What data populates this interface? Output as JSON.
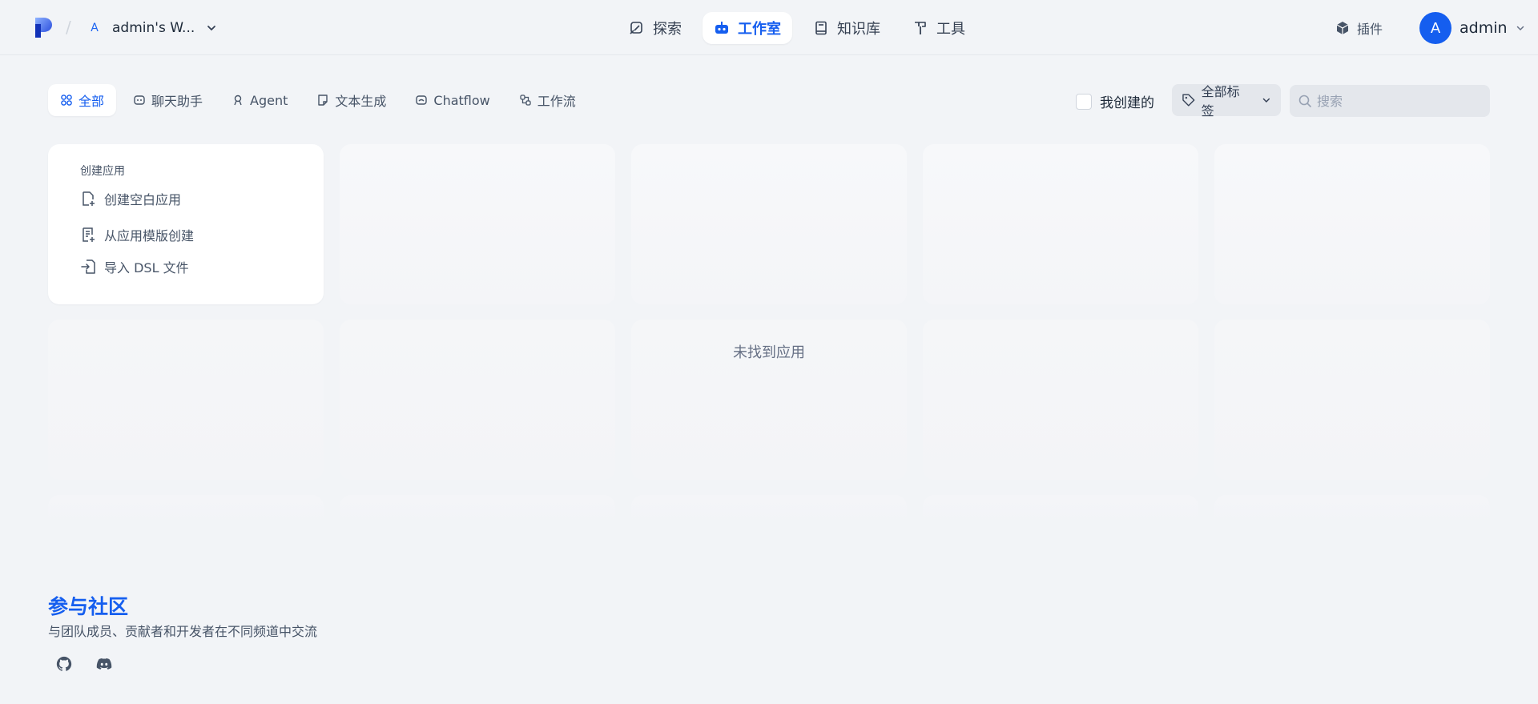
{
  "header": {
    "workspace": {
      "avatar_letter": "A",
      "name": "admin's W..."
    },
    "nav": [
      {
        "label": "探索",
        "icon": "explore-icon",
        "active": false
      },
      {
        "label": "工作室",
        "icon": "robot-icon",
        "active": true
      },
      {
        "label": "知识库",
        "icon": "book-icon",
        "active": false
      },
      {
        "label": "工具",
        "icon": "hammer-icon",
        "active": false
      }
    ],
    "plugins_label": "插件",
    "user": {
      "avatar_letter": "A",
      "name": "admin"
    }
  },
  "filters": {
    "tabs": [
      {
        "label": "全部",
        "icon": "grid-icon",
        "active": true
      },
      {
        "label": "聊天助手",
        "icon": "chat-bot-icon",
        "active": false
      },
      {
        "label": "Agent",
        "icon": "agent-icon",
        "active": false
      },
      {
        "label": "文本生成",
        "icon": "note-icon",
        "active": false
      },
      {
        "label": "Chatflow",
        "icon": "chatflow-icon",
        "active": false
      },
      {
        "label": "工作流",
        "icon": "workflow-icon",
        "active": false
      }
    ],
    "mine_label": "我创建的",
    "tag_label": "全部标签",
    "search_placeholder": "搜索"
  },
  "create_card": {
    "title": "创建应用",
    "items": [
      {
        "label": "创建空白应用",
        "icon": "blank-file-plus-icon"
      },
      {
        "label": "从应用模版创建",
        "icon": "template-file-icon"
      },
      {
        "label": "导入 DSL 文件",
        "icon": "import-file-icon"
      }
    ]
  },
  "empty_message": "未找到应用",
  "footer": {
    "title": "参与社区",
    "description": "与团队成员、贡献者和开发者在不同频道中交流",
    "links": [
      {
        "icon": "github-icon"
      },
      {
        "icon": "discord-icon"
      }
    ]
  },
  "colors": {
    "accent": "#155eef",
    "background": "#f2f4f7",
    "text": "#354052",
    "muted": "#667085"
  }
}
